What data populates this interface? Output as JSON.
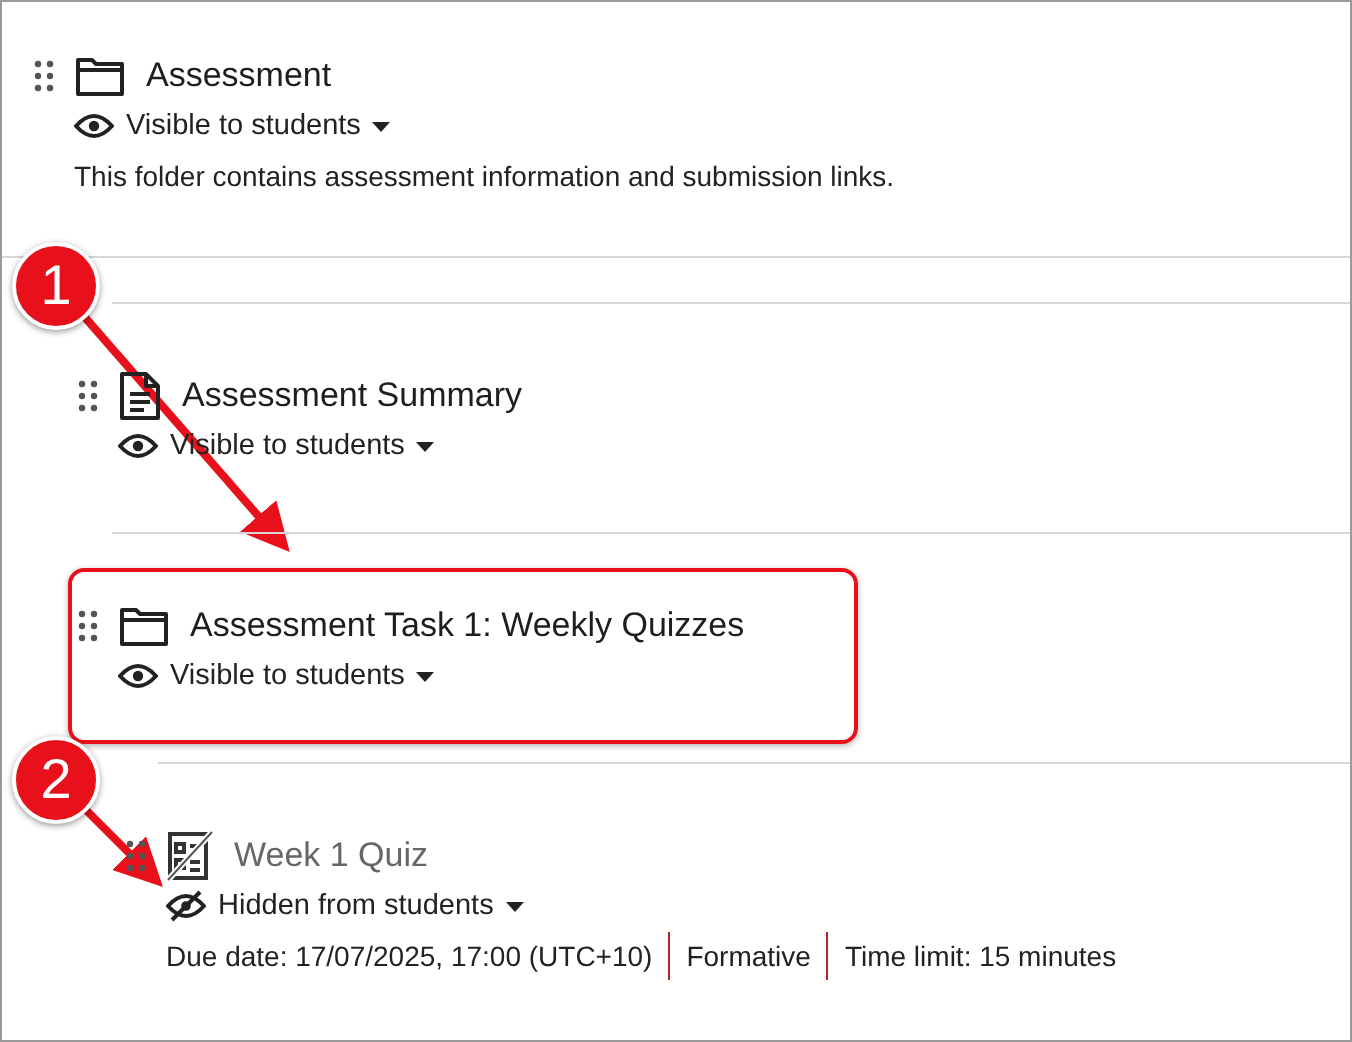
{
  "items": [
    {
      "title": "Assessment",
      "kind": "folder",
      "visible": true,
      "visibility_label": "Visible to students",
      "description": "This folder contains assessment information and submission links.",
      "children": [
        {
          "title": "Assessment Summary",
          "kind": "document",
          "visible": true,
          "visibility_label": "Visible to students",
          "highlighted": false
        },
        {
          "title": "Assessment Task 1: Weekly Quizzes",
          "kind": "folder",
          "visible": true,
          "visibility_label": "Visible to students",
          "highlighted": true,
          "children": [
            {
              "title": "Week 1 Quiz",
              "kind": "quiz",
              "visible": false,
              "visibility_label": "Hidden from students",
              "details": [
                "Due date: 17/07/2025, 17:00 (UTC+10)",
                "Formative",
                "Time limit: 15 minutes"
              ]
            }
          ]
        }
      ]
    }
  ],
  "callouts": [
    {
      "label": "1"
    },
    {
      "label": "2"
    }
  ]
}
